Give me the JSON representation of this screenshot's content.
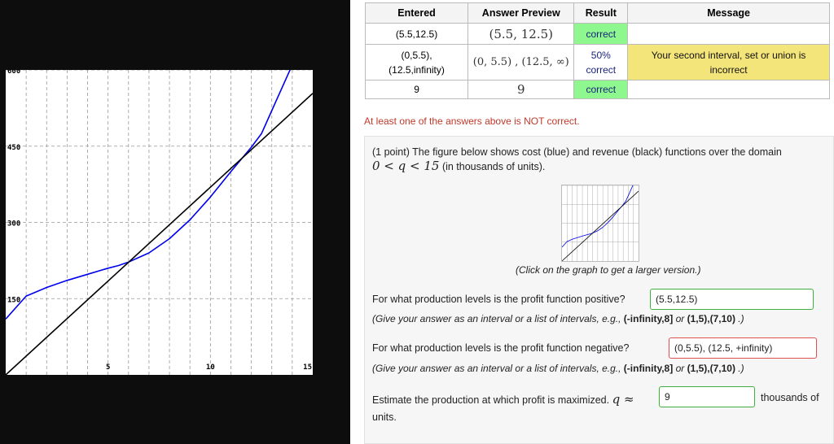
{
  "graph": {
    "y_ticks": [
      "600",
      "450",
      "300",
      "150"
    ],
    "x_ticks": [
      "5",
      "10",
      "15"
    ],
    "colors": {
      "cost": "#0000ee",
      "revenue": "#000000",
      "grid": "#999999"
    }
  },
  "chart_data": {
    "type": "line",
    "xlim": [
      0,
      15
    ],
    "ylim": [
      0,
      600
    ],
    "x_ticks": [
      5,
      10,
      15
    ],
    "y_ticks": [
      150,
      300,
      450,
      600
    ],
    "grid": true,
    "series": [
      {
        "color": "#0000ee",
        "x": [
          0,
          1,
          2,
          3,
          4,
          5,
          5.5,
          6,
          7,
          8,
          9,
          10,
          11,
          12,
          12.5,
          13,
          14
        ],
        "y": [
          110,
          155,
          172,
          186,
          198,
          210,
          215,
          222,
          240,
          268,
          305,
          350,
          400,
          448,
          475,
          520,
          610
        ]
      },
      {
        "color": "#000000",
        "x": [
          0,
          15
        ],
        "y": [
          0,
          554
        ]
      }
    ]
  },
  "table": {
    "headers": [
      "Entered",
      "Answer Preview",
      "Result",
      "Message"
    ],
    "rows": [
      {
        "entered": "(5.5,12.5)",
        "preview": "(5.5, 12.5)",
        "result": "correct",
        "message": ""
      },
      {
        "entered_line1": "(0,5.5),",
        "entered_line2": "(12.5,infinity)",
        "preview": "(0, 5.5) , (12.5, ∞)",
        "result_line1": "50%",
        "result_line2": "correct",
        "message": "Your second interval, set or union is incorrect"
      },
      {
        "entered": "9",
        "preview": "9",
        "result": "correct",
        "message": ""
      }
    ]
  },
  "warning": "At least one of the answers above is NOT correct.",
  "problem": {
    "intro": "(1 point) The figure below shows cost (blue) and revenue (black) functions over the domain",
    "domain_math": "0 < q < 15",
    "domain_suffix": "(in thousands of units).",
    "thumb_caption": "(Click on the graph to get a larger version.)",
    "q1": "For what production levels is the profit function positive?",
    "q1_answer": "(5.5,12.5)",
    "hint_prefix": "(Give your answer as an interval or a list of intervals, e.g., ",
    "hint_ex1": "(-infinity,8]",
    "hint_or": " or ",
    "hint_ex2": "(1,5),(7,10)",
    "hint_suffix": " .)",
    "q2": "For what production levels is the profit function negative?",
    "q2_answer": "(0,5.5), (12.5, +infinity)",
    "q3": "Estimate the production at which profit is maximized.",
    "q3_math": "q ≈",
    "q3_answer": "9",
    "q3_units_a": "thousands of",
    "q3_units_b": "units."
  }
}
